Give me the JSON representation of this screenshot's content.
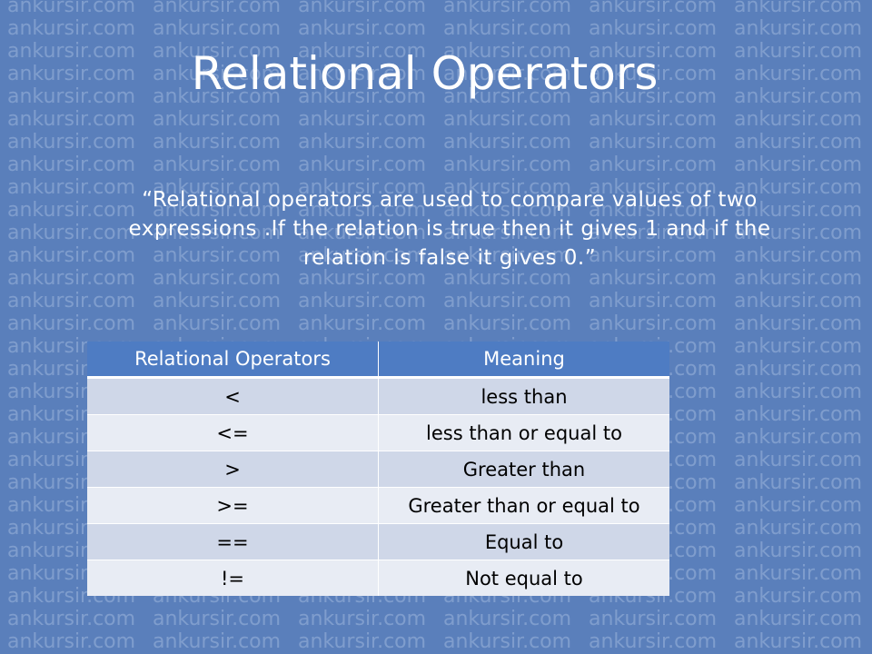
{
  "watermark": "ankursir.com",
  "slide": {
    "title": "Relational Operators",
    "definition": "“Relational operators are used to compare values of two expressions .If the relation is true then it gives 1 and if the relation is false it gives 0.”"
  },
  "table": {
    "headers": [
      "Relational Operators",
      "Meaning"
    ],
    "rows": [
      {
        "operator": "<",
        "meaning": "less than"
      },
      {
        "operator": "<=",
        "meaning": "less than or equal to"
      },
      {
        "operator": ">",
        "meaning": "Greater than"
      },
      {
        "operator": ">=",
        "meaning": "Greater than or equal to"
      },
      {
        "operator": "==",
        "meaning": "Equal to"
      },
      {
        "operator": "!=",
        "meaning": "Not equal to"
      }
    ]
  },
  "colors": {
    "background": "#5a7fbb",
    "header": "#4e7cc3",
    "row_odd": "#cfd7e8",
    "row_even": "#e8ecf4"
  }
}
